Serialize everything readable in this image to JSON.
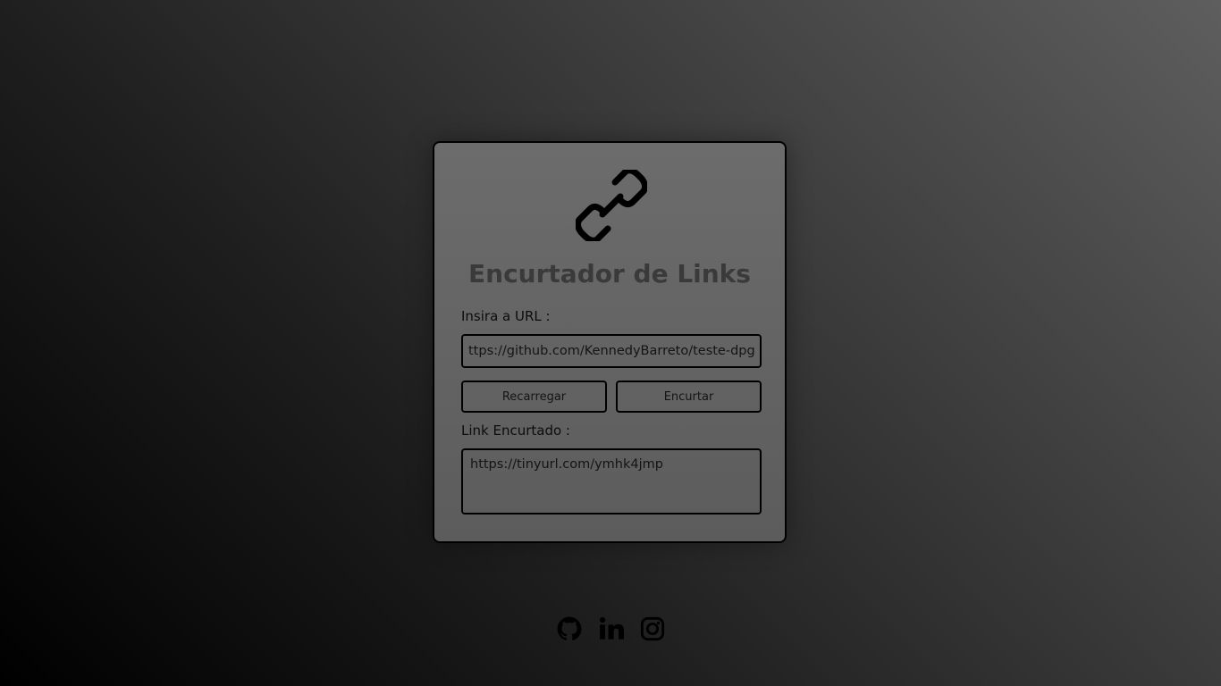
{
  "app": {
    "title": "Encurtador de Links",
    "logo_icon": "link-icon"
  },
  "form": {
    "url_label": "Insira a URL :",
    "url_value": "ttps://github.com/KennedyBarreto/teste-dpg",
    "reload_label": "Recarregar",
    "shorten_label": "Encurtar",
    "short_label": "Link Encurtado :",
    "short_value": "https://tinyurl.com/ymhk4jmp"
  },
  "social": [
    {
      "icon": "github-icon"
    },
    {
      "icon": "linkedin-icon"
    },
    {
      "icon": "instagram-icon"
    }
  ],
  "colors": {
    "border": "#000000",
    "title": "#3a3a3a",
    "card_top": "#6c6c6c",
    "card_bottom": "#5c5c5c"
  }
}
